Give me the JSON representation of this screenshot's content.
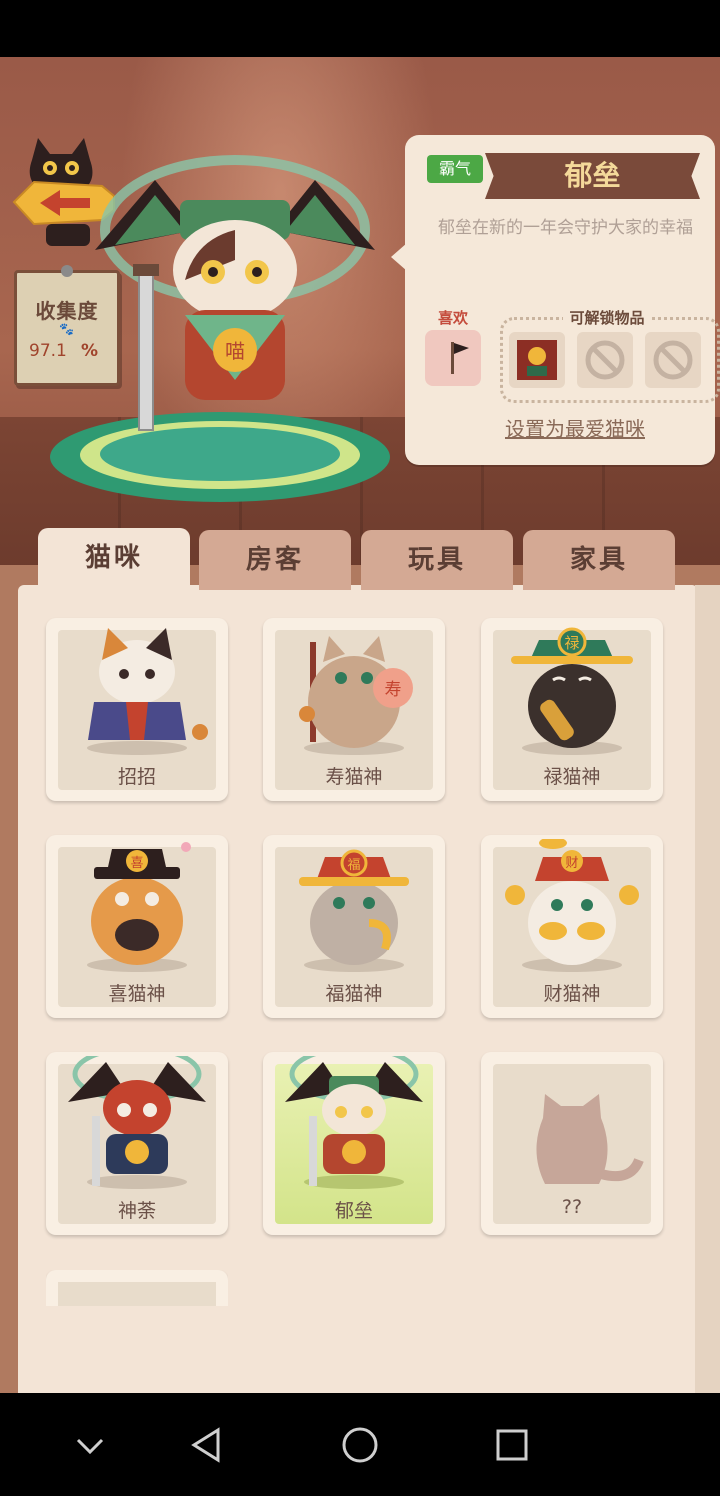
{
  "colors": {
    "trait_green": "#4ca845",
    "ribbon_brown": "#7a4a3a",
    "ribbon_text": "#f4d99a",
    "selected_card": "#d3e48a"
  },
  "collection": {
    "title": "收集度",
    "value": "97.1",
    "unit": "%"
  },
  "detail": {
    "trait": "霸气",
    "name": "郁垒",
    "description": "郁垒在新的一年会守护大家的幸福",
    "likes_label": "喜欢",
    "unlock_label": "可解锁物品",
    "set_favorite": "设置为最爱猫咪"
  },
  "tabs": [
    {
      "label": "猫咪",
      "active": true
    },
    {
      "label": "房客",
      "active": false
    },
    {
      "label": "玩具",
      "active": false
    },
    {
      "label": "家具",
      "active": false
    }
  ],
  "cats": [
    {
      "name": "招招",
      "icon": "calico-kimono-cat"
    },
    {
      "name": "寿猫神",
      "icon": "longevity-god-cat"
    },
    {
      "name": "禄猫神",
      "icon": "prosperity-god-cat"
    },
    {
      "name": "喜猫神",
      "icon": "happiness-god-cat"
    },
    {
      "name": "福猫神",
      "icon": "fortune-god-cat"
    },
    {
      "name": "财猫神",
      "icon": "wealth-god-cat"
    },
    {
      "name": "神荼",
      "icon": "door-god-red-cat"
    },
    {
      "name": "郁垒",
      "icon": "door-god-green-cat",
      "selected": true
    },
    {
      "name": "??",
      "icon": "unknown-cat-silhouette"
    }
  ]
}
